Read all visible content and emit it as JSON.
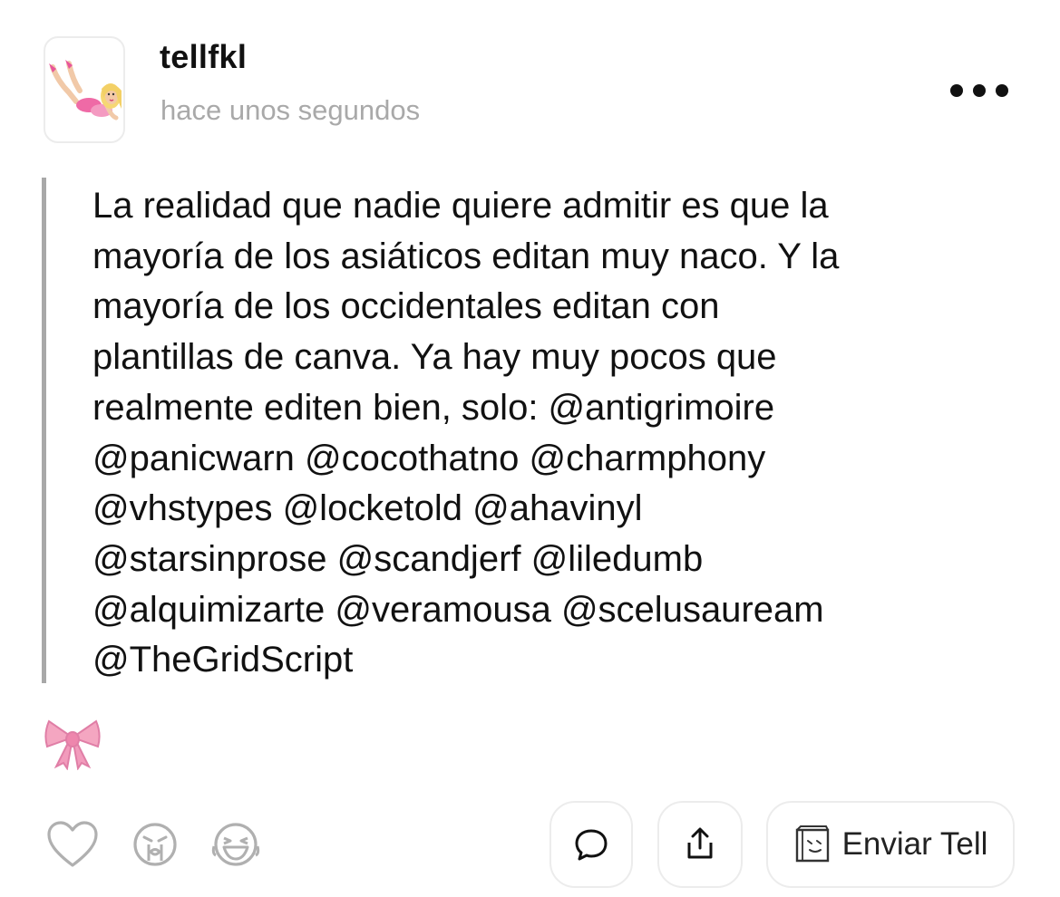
{
  "post": {
    "username": "tellfkl",
    "timestamp": "hace unos segundos",
    "text": "La realidad que nadie quiere admitir es que la\nmayoría de los asiáticos editan muy naco. Y la\nmayoría de los occidentales editan con\nplantillas de canva. Ya hay muy pocos que\nrealmente editen bien, solo: @antigrimoire\n@panicwarn @cocothatno @charmphony\n@vhstypes @locketold @ahavinyl\n@starsinprose @scandjerf @liledumb\n@alquimizarte @veramousa @scelusauream\n@TheGridScript",
    "emoji": "🎀"
  },
  "actions": {
    "send_label": "Enviar Tell"
  },
  "icons": {
    "avatar": "avatar-sticker-doll",
    "more": "more-dots-icon",
    "reactions": [
      "heart-icon",
      "crying-face-icon",
      "laughing-face-icon"
    ],
    "comment": "comment-bubble-icon",
    "share": "share-upload-icon",
    "send": "paper-bag-icon"
  },
  "colors": {
    "timestamp": "#a9a9a9",
    "quote_bar": "#a8a8a8",
    "icon_gray": "#b0b0b0",
    "bow_pink": "#f4a6c1"
  }
}
